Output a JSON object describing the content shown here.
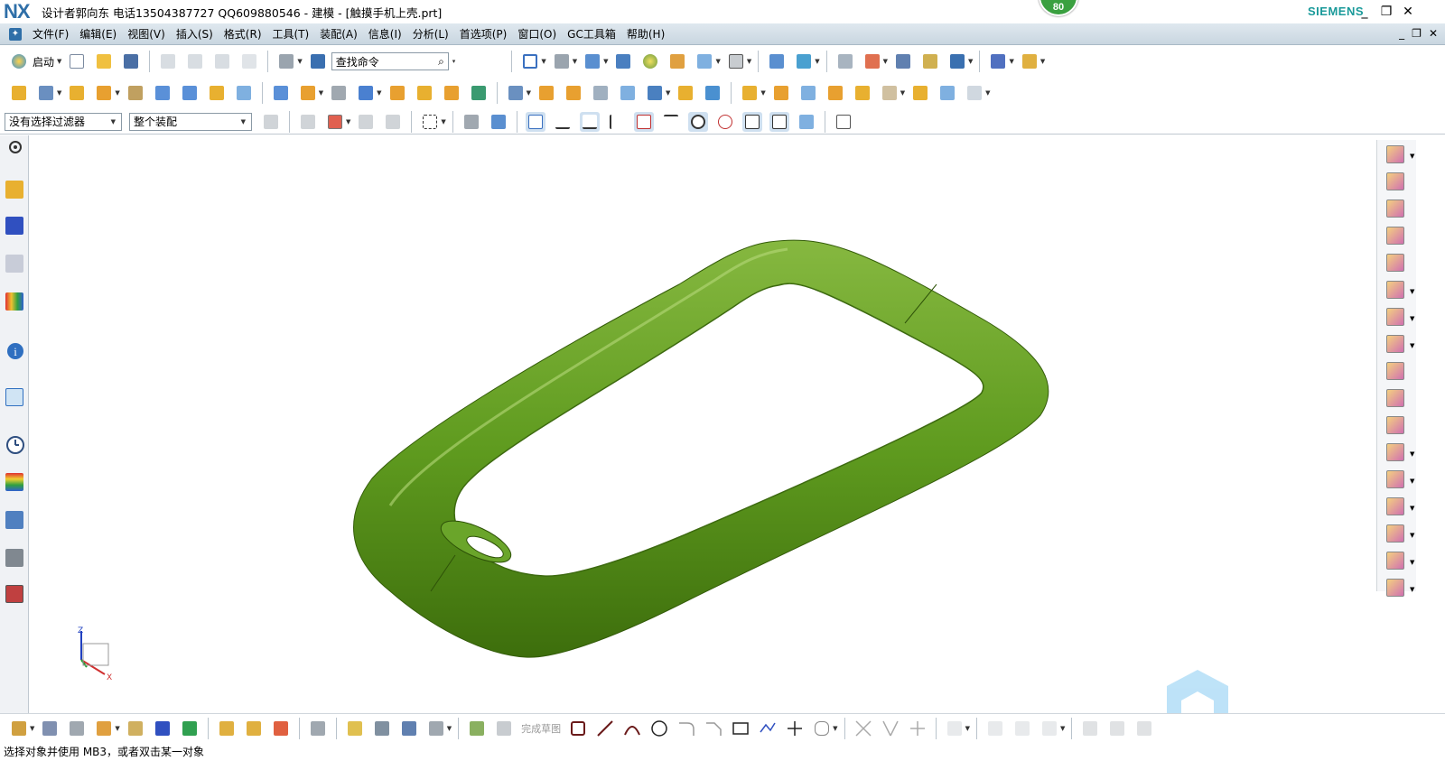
{
  "window": {
    "logo": "NX",
    "title": "设计者郭向东  电话13504387727  QQ609880546 - 建模 - [触摸手机上壳.prt]",
    "brand": "SIEMENS",
    "badge_value": "80",
    "controls": [
      "_",
      "❐",
      "✕"
    ]
  },
  "menu": {
    "items": [
      "文件(F)",
      "编辑(E)",
      "视图(V)",
      "插入(S)",
      "格式(R)",
      "工具(T)",
      "装配(A)",
      "信息(I)",
      "分析(L)",
      "首选项(P)",
      "窗口(O)",
      "GC工具箱",
      "帮助(H)"
    ],
    "controls": [
      "_",
      "❐",
      "✕"
    ]
  },
  "toolbar1": {
    "start_label": "启动",
    "search_placeholder": "查找命令"
  },
  "toolbar3": {
    "selection_filter": "没有选择过滤器",
    "assembly_scope": "整个装配"
  },
  "bottom_toolbar": {
    "finish_sketch": "完成草图"
  },
  "status": {
    "prompt": "选择对象并使用 MB3，或者双击某一对象"
  },
  "view_triad": {
    "z": "Z",
    "x": "X"
  },
  "colors": {
    "model_green": "#5f9b1f",
    "model_dark": "#3d6e0c",
    "accent": "#2f6fa8",
    "brand": "#1a9a9a",
    "badge": "#3aa040"
  }
}
